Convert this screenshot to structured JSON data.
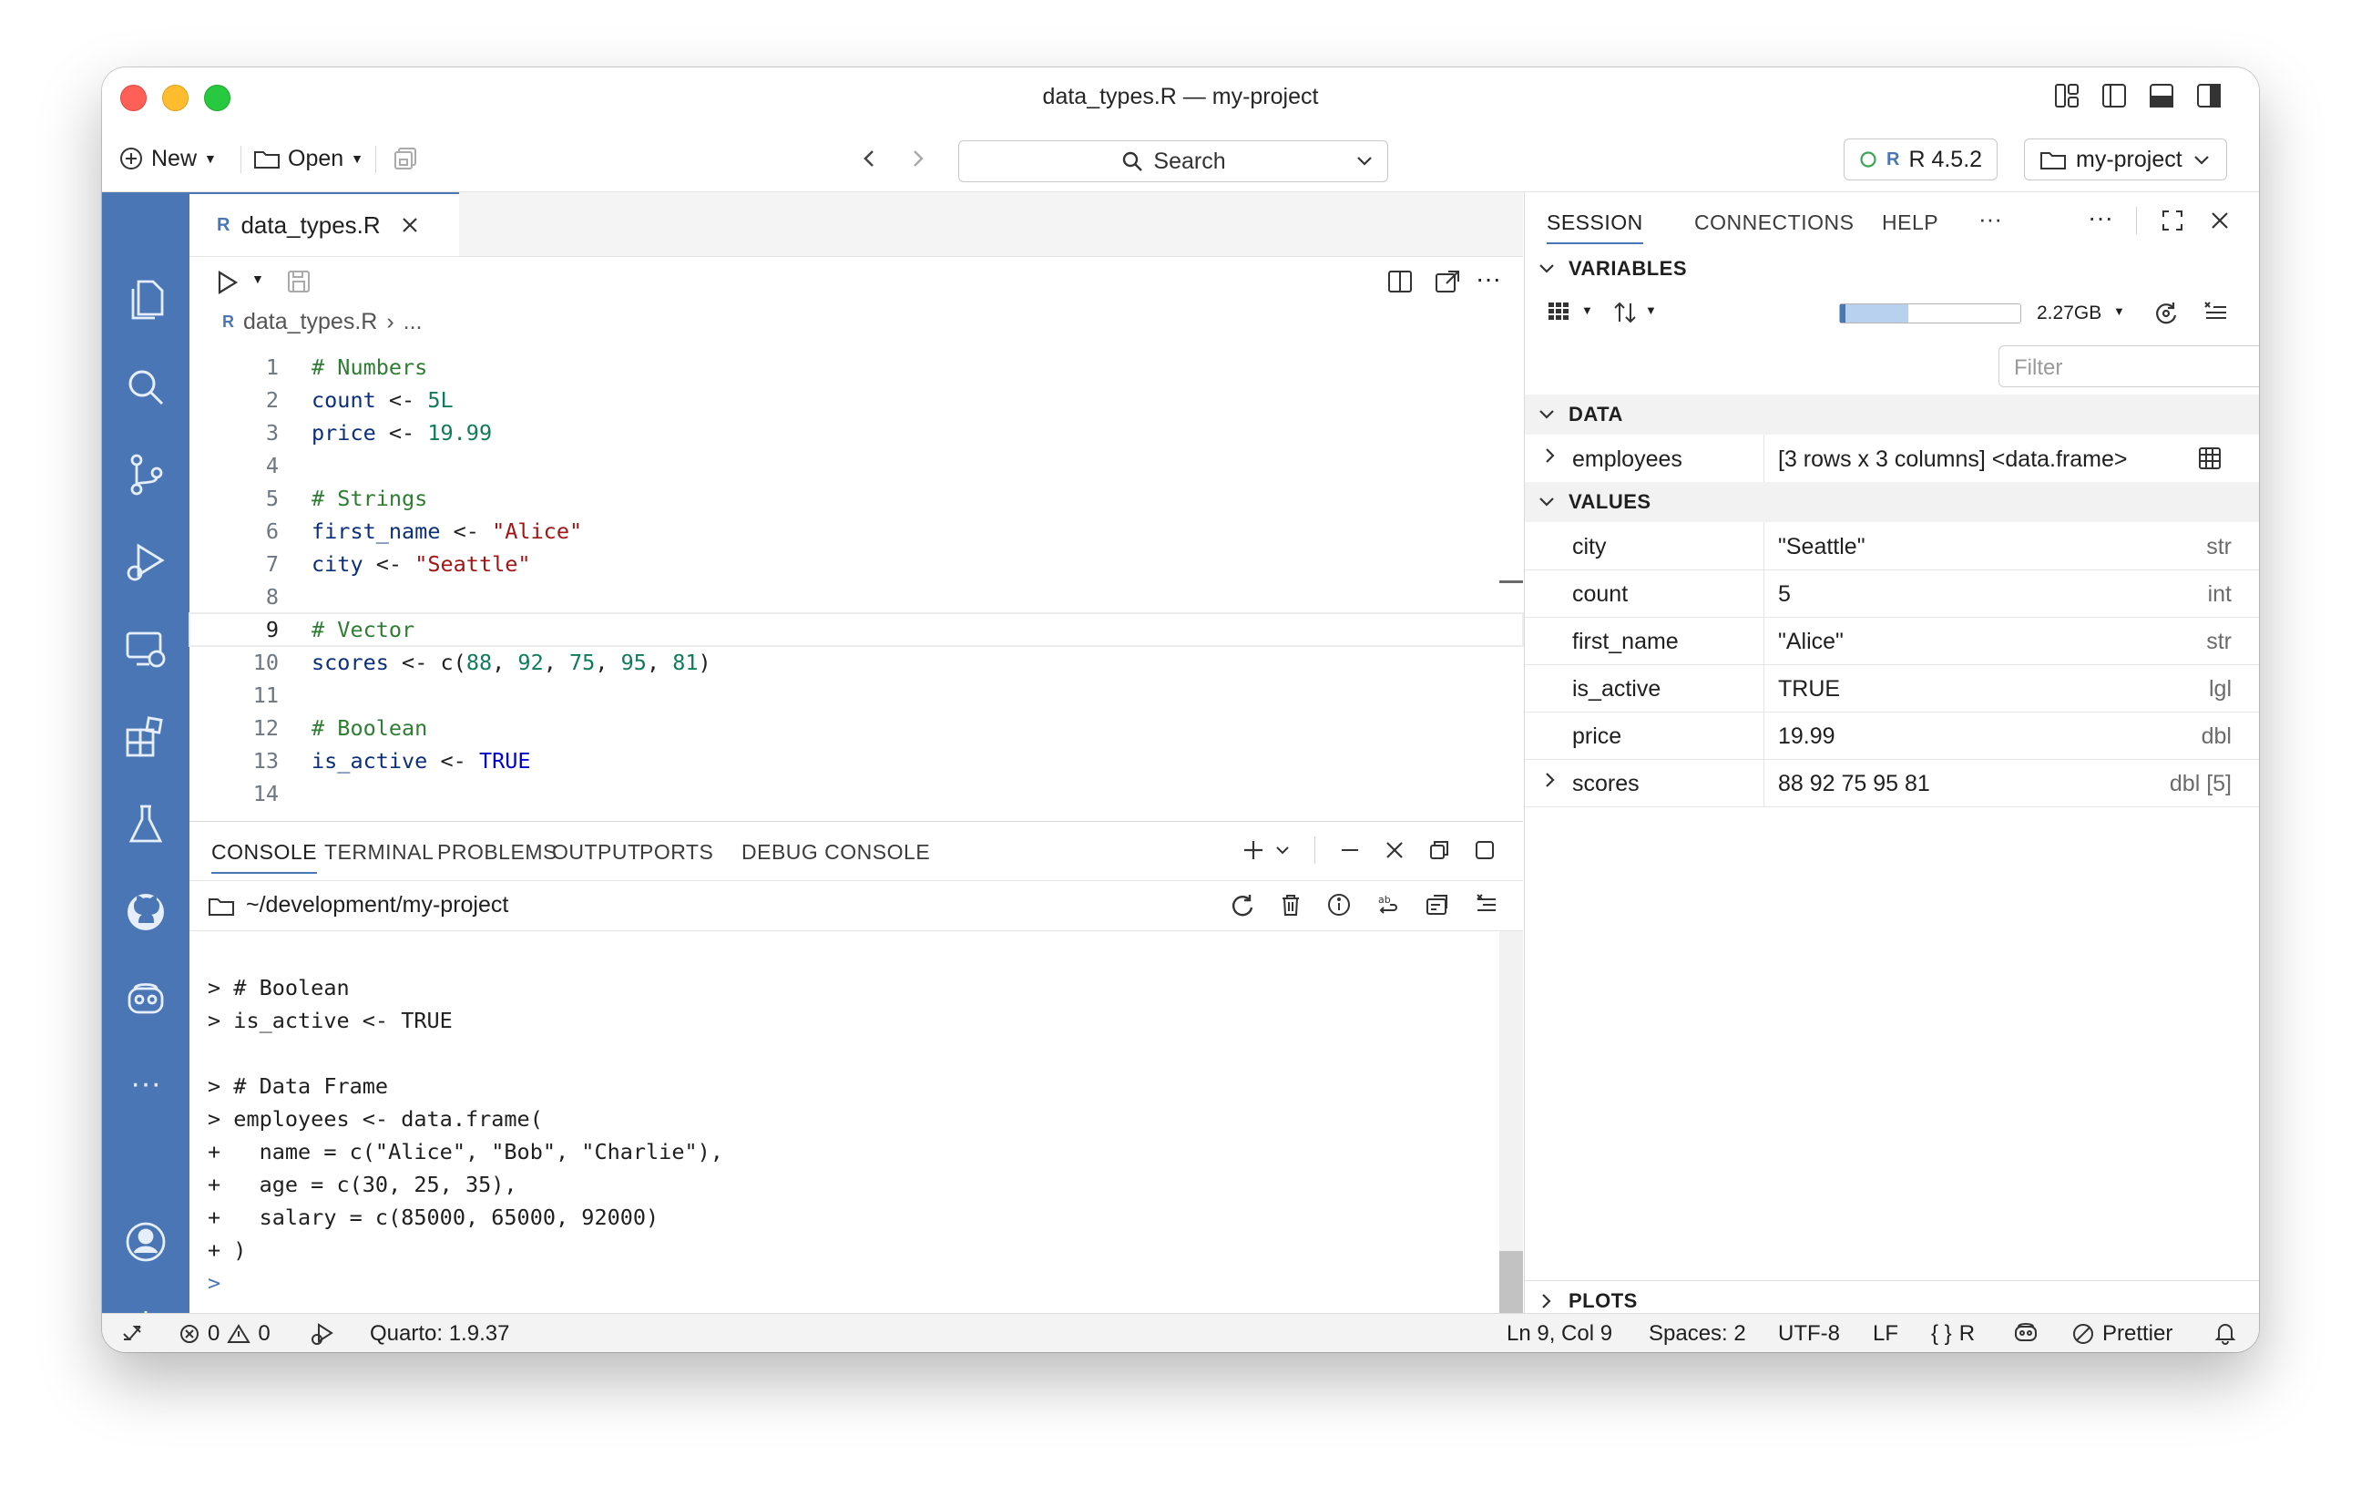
{
  "window": {
    "title": "data_types.R — my-project"
  },
  "toolbar": {
    "new_label": "New",
    "open_label": "Open",
    "search_label": "Search",
    "interpreter_label": "R 4.5.2",
    "project_label": "my-project"
  },
  "editor": {
    "tab_label": "data_types.R",
    "breadcrumb_file": "data_types.R",
    "breadcrumb_more": "...",
    "lines": [
      {
        "n": "1",
        "text": "# Numbers"
      },
      {
        "n": "2",
        "text": "count <- 5L"
      },
      {
        "n": "3",
        "text": "price <- 19.99"
      },
      {
        "n": "4",
        "text": ""
      },
      {
        "n": "5",
        "text": "# Strings"
      },
      {
        "n": "6",
        "text": "first_name <- \"Alice\""
      },
      {
        "n": "7",
        "text": "city <- \"Seattle\""
      },
      {
        "n": "8",
        "text": ""
      },
      {
        "n": "9",
        "text": "# Vector"
      },
      {
        "n": "10",
        "text": "scores <- c(88, 92, 75, 95, 81)"
      },
      {
        "n": "11",
        "text": ""
      },
      {
        "n": "12",
        "text": "# Boolean"
      },
      {
        "n": "13",
        "text": "is_active <- TRUE"
      },
      {
        "n": "14",
        "text": ""
      }
    ]
  },
  "panel": {
    "tabs": [
      "CONSOLE",
      "TERMINAL",
      "PROBLEMS",
      "OUTPUT",
      "PORTS",
      "DEBUG CONSOLE"
    ],
    "active_tab": "CONSOLE",
    "console_path": "~/development/my-project",
    "console_lines": [
      "> # Boolean",
      "> is_active <- TRUE",
      "",
      "> # Data Frame",
      "> employees <- data.frame(",
      "+   name = c(\"Alice\", \"Bob\", \"Charlie\"),",
      "+   age = c(30, 25, 35),",
      "+   salary = c(85000, 65000, 92000)",
      "+ )",
      ">"
    ]
  },
  "session": {
    "tabs": [
      "SESSION",
      "CONNECTIONS",
      "HELP"
    ],
    "more": "···",
    "variables_header": "VARIABLES",
    "memory_label": "2.27GB",
    "memory_fraction": 0.35,
    "filter_placeholder": "Filter",
    "data_header": "DATA",
    "data_rows": [
      {
        "name": "employees",
        "value": "[3 rows x 3 columns] <data.frame>"
      }
    ],
    "values_header": "VALUES",
    "value_rows": [
      {
        "name": "city",
        "value": "\"Seattle\"",
        "type": "str"
      },
      {
        "name": "count",
        "value": "5",
        "type": "int"
      },
      {
        "name": "first_name",
        "value": "\"Alice\"",
        "type": "str"
      },
      {
        "name": "is_active",
        "value": "TRUE",
        "type": "lgl"
      },
      {
        "name": "price",
        "value": "19.99",
        "type": "dbl"
      },
      {
        "name": "scores",
        "value": "88 92 75 95 81",
        "type": "dbl [5]"
      }
    ],
    "plots_header": "PLOTS"
  },
  "status": {
    "errors": "0",
    "warnings": "0",
    "quarto": "Quarto: 1.9.37",
    "cursor": "Ln 9, Col 9",
    "spaces": "Spaces: 2",
    "encoding": "UTF-8",
    "eol": "LF",
    "language": "R",
    "formatter": "Prettier"
  },
  "colors": {
    "accent": "#4a76b5",
    "activity_bar": "#4a76b5",
    "comment": "#2e7d32",
    "string": "#a31515",
    "number": "#0f7b5b",
    "keyword": "#0000c8"
  }
}
